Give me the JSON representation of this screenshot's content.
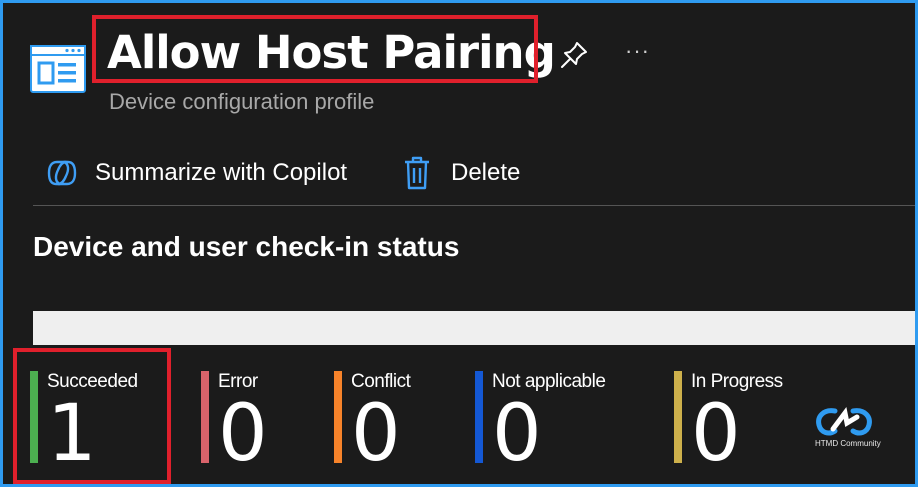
{
  "header": {
    "title": "Allow Host Pairing",
    "subtitle": "Device configuration profile",
    "more": "···",
    "icons": {
      "profile": "profile-icon",
      "pin": "pin-icon"
    }
  },
  "toolbar": {
    "copilot_label": "Summarize with Copilot",
    "delete_label": "Delete"
  },
  "section": {
    "title": "Device and user check-in status"
  },
  "status": {
    "tiles": [
      {
        "label": "Succeeded",
        "value": "1",
        "color": "#4caf50"
      },
      {
        "label": "Error",
        "value": "0",
        "color": "#d9636b"
      },
      {
        "label": "Conflict",
        "value": "0",
        "color": "#f7832a"
      },
      {
        "label": "Not applicable",
        "value": "0",
        "color": "#1458d4"
      },
      {
        "label": "In Progress",
        "value": "0",
        "color": "#cdb04b"
      }
    ]
  },
  "watermark": {
    "text": "HTMD Community"
  },
  "colors": {
    "accent_frame": "#2f9bf0",
    "highlight": "#e0202c",
    "background": "#1b1b1b"
  }
}
